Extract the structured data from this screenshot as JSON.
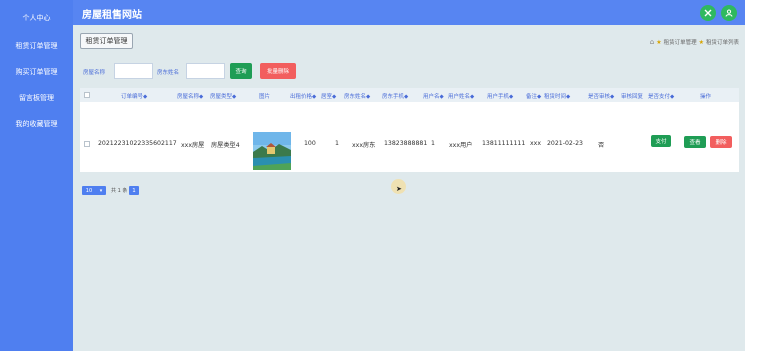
{
  "sidebar": {
    "items": [
      {
        "label": "个人中心"
      },
      {
        "label": "租赁订单管理"
      },
      {
        "label": "购买订单管理"
      },
      {
        "label": "留言板管理"
      },
      {
        "label": "我的收藏管理"
      }
    ]
  },
  "header": {
    "title": "房屋租售网站",
    "icons": [
      "expand-icon",
      "user-icon"
    ],
    "icon_color": "#2fb95f"
  },
  "content": {
    "tab_label": "租赁订单管理",
    "breadcrumb": [
      "租赁订单管理",
      "租赁订单列表"
    ]
  },
  "filters": {
    "house_name_label": "房屋名称",
    "owner_name_label": "房东姓名",
    "house_name_value": "",
    "owner_name_value": "",
    "query_button": "查询",
    "batch_delete_button": "批量删除"
  },
  "table": {
    "columns": [
      "订单编号",
      "房屋名称",
      "房屋类型",
      "图片",
      "出租价格",
      "居室",
      "房东姓名",
      "房东手机",
      "用户名",
      "用户姓名",
      "用户手机",
      "备注",
      "租赁时间",
      "是否审核",
      "审核回复",
      "是否支付",
      "操作"
    ],
    "sortable_suffix": "◆",
    "rows": [
      {
        "order_no": "20212231022335602117",
        "house_name": "xxx房屋",
        "house_type": "房屋类型4",
        "price": "100",
        "rooms": "1",
        "owner_name": "xxx房东",
        "owner_phone": "13823888881",
        "username": "1",
        "user_name": "xxx用户",
        "user_phone": "13811111111",
        "remark": "xxx",
        "rent_date": "2021-02-23",
        "reviewed": "否",
        "review_reply": "",
        "paid": "",
        "pay_button": "支付",
        "view_button": "查看",
        "delete_button": "删除"
      }
    ]
  },
  "pagination": {
    "page_size": "10",
    "total_text": "共 1 条",
    "current_page": "1"
  },
  "colors": {
    "sidebar": "#4f7ff0",
    "topbar": "#5785f2",
    "green": "#1f9d55",
    "red": "#f25e5e"
  }
}
